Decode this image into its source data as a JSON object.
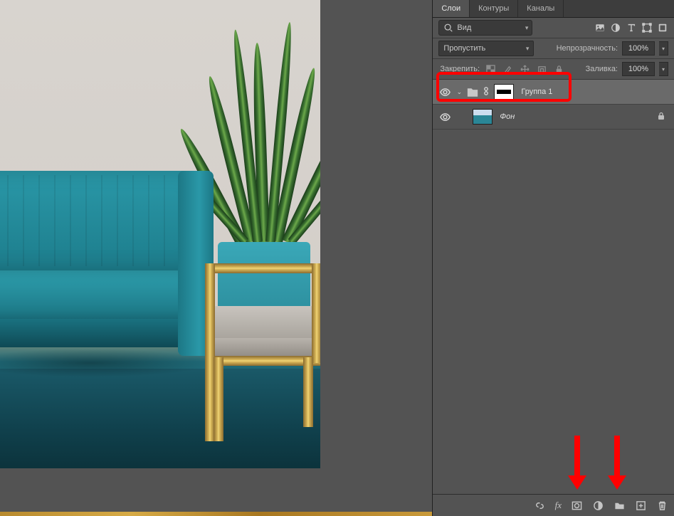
{
  "tabs": {
    "layers": "Слои",
    "paths": "Контуры",
    "channels": "Каналы"
  },
  "search": {
    "placeholder": "Вид"
  },
  "blend": {
    "mode": "Пропустить",
    "opacity_label": "Непрозрачность:",
    "opacity_value": "100%"
  },
  "lock": {
    "label": "Закрепить:",
    "fill_label": "Заливка:",
    "fill_value": "100%"
  },
  "layers": {
    "group": {
      "name": "Группа 1"
    },
    "background": {
      "name": "Фон"
    }
  }
}
